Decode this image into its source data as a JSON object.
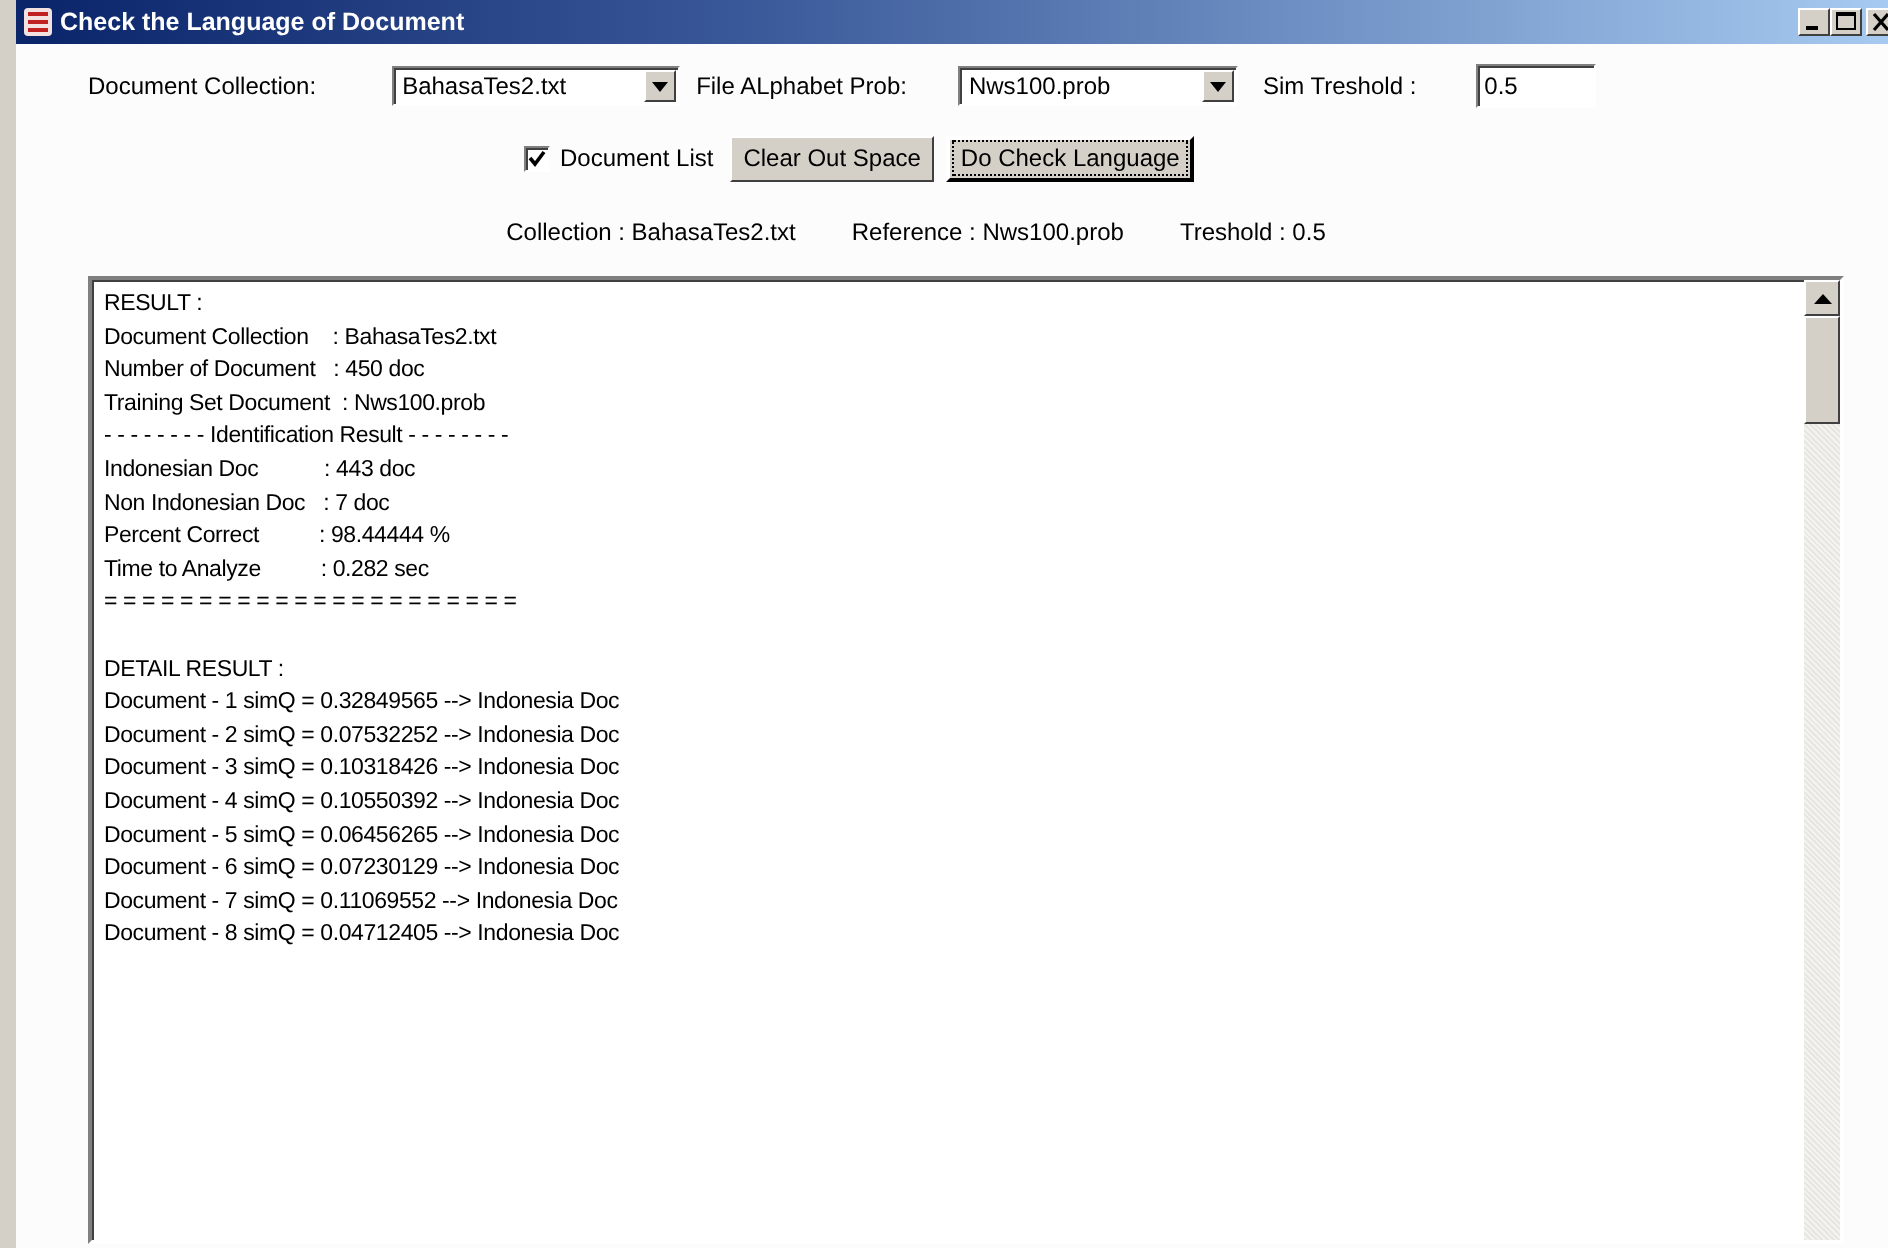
{
  "window": {
    "title": "Check the Language of Document"
  },
  "controls": {
    "collection_label": "Document Collection:",
    "collection_value": "BahasaTes2.txt",
    "alphabet_label": "File ALphabet Prob:",
    "alphabet_value": "Nws100.prob",
    "threshold_label": "Sim Treshold  :",
    "threshold_value": "0.5"
  },
  "options": {
    "document_list": {
      "label": "Document List",
      "checked": true
    },
    "buttons": [
      {
        "label": "Clear Out Space",
        "focused": false
      },
      {
        "label": "Do Check Language",
        "focused": true
      }
    ]
  },
  "summary": [
    "Collection : BahasaTes2.txt",
    "Reference : Nws100.prob",
    "Treshold : 0.5"
  ],
  "result_lines": [
    {
      "kind": "line",
      "text": "RESULT :"
    },
    {
      "kind": "line",
      "text": "Document Collection    : BahasaTes2.txt"
    },
    {
      "kind": "line",
      "text": "Number of Document   : 450 doc"
    },
    {
      "kind": "line",
      "text": "Training Set Document  : Nws100.prob"
    },
    {
      "kind": "line",
      "text": "- - - - - - - - Identification Result - - - - - - - -"
    },
    {
      "kind": "line",
      "text": "Indonesian Doc           : 443 doc"
    },
    {
      "kind": "line",
      "text": "Non Indonesian Doc   : 7 doc"
    },
    {
      "kind": "line",
      "text": "Percent Correct          : 98.44444 %"
    },
    {
      "kind": "line",
      "text": "Time to Analyze          : 0.282 sec"
    },
    {
      "kind": "line",
      "text": "= = = = = = = = = = = = = = = = = = = = = ="
    },
    {
      "kind": "section",
      "text": "DETAIL RESULT :"
    },
    {
      "kind": "line",
      "text": "Document - 1 simQ = 0.32849565 --> Indonesia Doc"
    },
    {
      "kind": "line",
      "text": "Document - 2 simQ = 0.07532252 --> Indonesia Doc"
    },
    {
      "kind": "line",
      "text": "Document - 3 simQ = 0.10318426 --> Indonesia Doc"
    },
    {
      "kind": "line",
      "text": "Document - 4 simQ = 0.10550392 --> Indonesia Doc"
    },
    {
      "kind": "line",
      "text": "Document - 5 simQ = 0.06456265 --> Indonesia Doc"
    },
    {
      "kind": "line",
      "text": "Document - 6 simQ = 0.07230129 --> Indonesia Doc"
    },
    {
      "kind": "line",
      "text": "Document - 7 simQ = 0.11069552 --> Indonesia Doc"
    },
    {
      "kind": "line",
      "text": "Document - 8 simQ = 0.04712405 --> Indonesia Doc"
    }
  ]
}
